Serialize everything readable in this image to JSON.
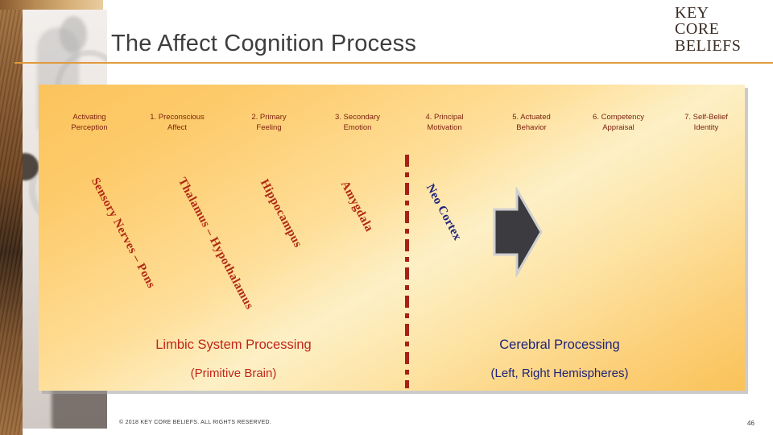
{
  "slide": {
    "title": "The Affect Cognition Process",
    "logo": {
      "line1": "KEY",
      "line2": "CORE",
      "line3": "BELIEFS"
    },
    "footer": {
      "copyright": "© 2018 KEY CORE BELIEFS. ALL RIGHTS RESERVED.",
      "page_number": "46"
    }
  },
  "stages": [
    {
      "label": "Activating\nPerception"
    },
    {
      "label": "1.  Preconscious\nAffect"
    },
    {
      "label": "2.  Primary\nFeeling"
    },
    {
      "label": "3.  Secondary\nEmotion"
    },
    {
      "label": "4.  Principal\nMotivation"
    },
    {
      "label": "5. Actuated\nBehavior"
    },
    {
      "label": "6. Competency\nAppraisal"
    },
    {
      "label": "7. Self-Belief\nIdentity"
    }
  ],
  "brain_labels": [
    {
      "text": "Sensory Nerves – Pons",
      "color": "#b02a14"
    },
    {
      "text": "Thalamus – Hypothalamus",
      "color": "#b02a14"
    },
    {
      "text": "Hippocampus",
      "color": "#b02a14"
    },
    {
      "text": "Amygdala",
      "color": "#b02a14"
    },
    {
      "text": "Neo Cortex",
      "color": "#1e2277"
    }
  ],
  "captions": {
    "left": {
      "line1": "Limbic System Processing",
      "line2": "(Primitive Brain)",
      "color": "#c0261a"
    },
    "right": {
      "line1": "Cerebral Processing",
      "line2": "(Left, Right Hemispheres)",
      "color": "#1e2277"
    }
  },
  "colors": {
    "panel_start": "#fcc35c",
    "panel_mid": "#fdf0c6",
    "panel_end": "#fac258",
    "rule": "#e09a3c",
    "divider": "#a62116",
    "arrow": "#3b3b40"
  }
}
